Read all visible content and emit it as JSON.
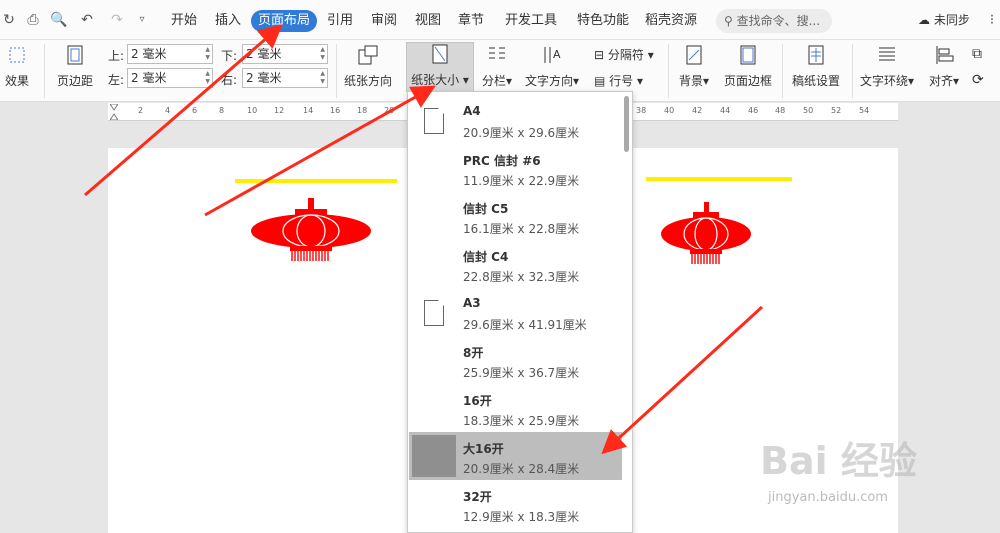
{
  "tabs": [
    "开始",
    "插入",
    "页面布局",
    "引用",
    "审阅",
    "视图",
    "章节",
    "开发工具",
    "特色功能",
    "稻壳资源"
  ],
  "active_tab": "页面布局",
  "search_placeholder": "查找命令、搜...",
  "sync_label": "未同步",
  "ribbon": {
    "effects": "效果",
    "margins": "页边距",
    "margin_top_label": "上:",
    "margin_top_value": "2 毫米",
    "margin_bottom_label": "下:",
    "margin_bottom_value": "2 毫米",
    "margin_left_label": "左:",
    "margin_left_value": "2 毫米",
    "margin_right_label": "右:",
    "margin_right_value": "2 毫米",
    "orientation": "纸张方向",
    "paper_size": "纸张大小",
    "columns": "分栏",
    "text_direction": "文字方向",
    "separator": "分隔符",
    "line_number": "行号",
    "background": "背景",
    "page_border": "页面边框",
    "draft_setting": "稿纸设置",
    "text_wrap": "文字环绕",
    "align": "对齐"
  },
  "ruler_numbers": [
    "2",
    "4",
    "6",
    "8",
    "10",
    "12",
    "14",
    "16",
    "18",
    "20",
    "38",
    "40",
    "42",
    "44",
    "46",
    "48",
    "50",
    "52",
    "54"
  ],
  "paper_sizes": [
    {
      "name": "A4",
      "dims": "20.9厘米  x  29.6厘米"
    },
    {
      "name": "PRC 信封 #6",
      "dims": "11.9厘米  x  22.9厘米"
    },
    {
      "name": "信封 C5",
      "dims": "16.1厘米  x  22.8厘米"
    },
    {
      "name": "信封 C4",
      "dims": "22.8厘米  x  32.3厘米"
    },
    {
      "name": "A3",
      "dims": "29.6厘米  x  41.91厘米"
    },
    {
      "name": "8开",
      "dims": "25.9厘米  x  36.7厘米"
    },
    {
      "name": "16开",
      "dims": "18.3厘米  x  25.9厘米"
    },
    {
      "name": "大16开",
      "dims": "20.9厘米  x  28.4厘米"
    },
    {
      "name": "32开",
      "dims": "12.9厘米  x  18.3厘米"
    }
  ],
  "hovered_paper": "大16开",
  "watermark": "Bai 经验",
  "watermark_url": "jingyan.baidu.com",
  "colors": {
    "accent": "#2f7bd6",
    "arrow": "#ff2a1a",
    "lantern": "#ff0000",
    "highlight": "#ffee00"
  }
}
